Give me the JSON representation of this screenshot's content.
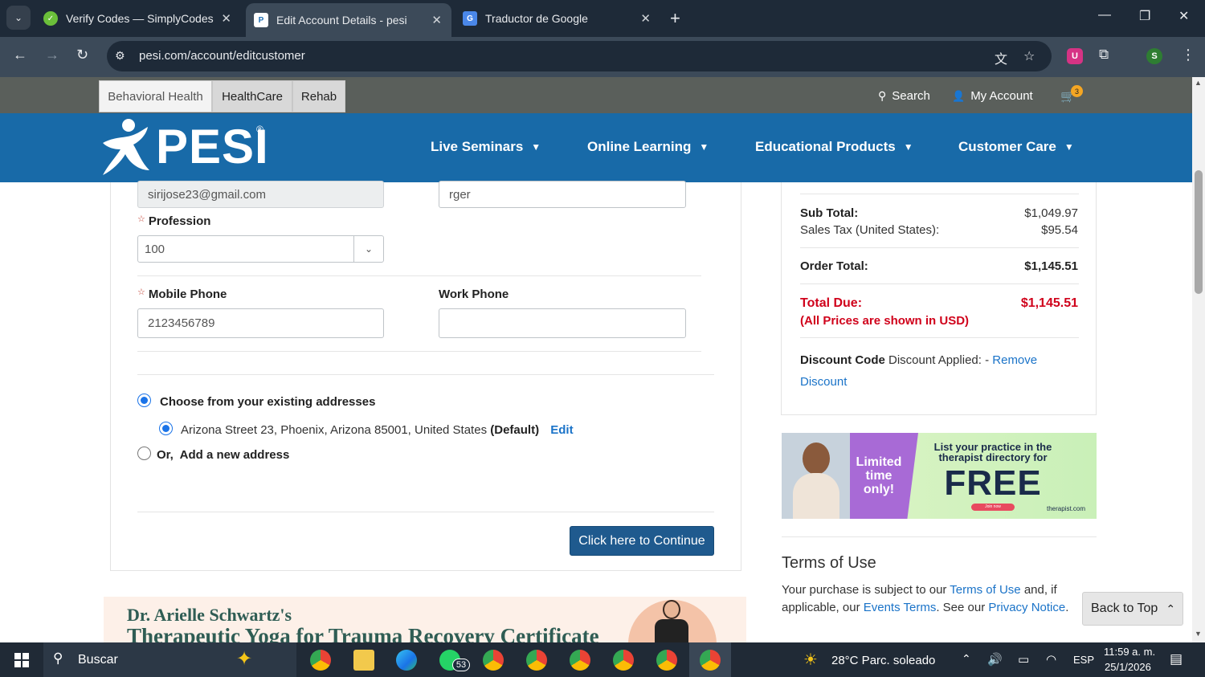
{
  "browser": {
    "tabs": [
      {
        "title": "Verify Codes — SimplyCodes",
        "favicon": "simplycodes-icon",
        "color": "#6bbf3a"
      },
      {
        "title": "Edit Account Details - pesi",
        "favicon": "pesi-icon",
        "color": "#1f6fb3"
      },
      {
        "title": "Traductor de Google",
        "favicon": "google-translate-icon",
        "color": "#4a87e8"
      }
    ],
    "url": "pesi.com/account/editcustomer",
    "profile_initial": "S",
    "shield_initial": "U"
  },
  "site": {
    "top_tabs": [
      "Behavioral Health",
      "HealthCare",
      "Rehab"
    ],
    "search_label": "Search",
    "account_label": "My Account",
    "cart_count": "3",
    "logo_text": "PESI",
    "logo_mark": "®",
    "nav": [
      "Live Seminars",
      "Online Learning",
      "Educational Products",
      "Customer Care"
    ]
  },
  "form": {
    "email_value": "sirijose23@gmail.com",
    "right_top_value": "rger",
    "profession_label": "Profession",
    "profession_value": "100",
    "mobile_label": "Mobile Phone",
    "mobile_value": "2123456789",
    "work_label": "Work Phone",
    "work_value": "",
    "choose_existing_label": "Choose from your existing addresses",
    "address_text": "Arizona Street 23, Phoenix, Arizona 85001, United States",
    "address_default": "(Default)",
    "edit_label": "Edit",
    "add_new_label": "Or,  Add a new address",
    "continue_label": "Click here to Continue"
  },
  "summary": {
    "subtotal_label": "Sub Total:",
    "subtotal_value": "$1,049.97",
    "tax_label": "Sales Tax (United States):",
    "tax_value": "$95.54",
    "order_total_label": "Order Total:",
    "order_total_value": "$1,145.51",
    "total_due_label": "Total Due:",
    "total_due_value": "$1,145.51",
    "usd_note": "(All Prices are shown in USD)",
    "discount_label": "Discount Code",
    "discount_applied": "Discount Applied: -",
    "remove_discount": "Remove Discount"
  },
  "promo": {
    "limited": "Limited time only!",
    "line1": "List your practice in the",
    "line2": "therapist directory for",
    "free": "FREE",
    "join": "Join now",
    "brand": "therapist.com"
  },
  "terms": {
    "title": "Terms of Use",
    "t1": "Your purchase is subject to our ",
    "terms_link": "Terms of Use",
    "t2": " and, if applicable, our ",
    "events_link": "Events Terms",
    "t3": ". See our ",
    "privacy_link": "Privacy Notice",
    "t4": "."
  },
  "back_to_top": "Back to Top",
  "banner": {
    "line1": "Dr. Arielle Schwartz's",
    "line2": "Therapeutic Yoga for Trauma Recovery Certificate"
  },
  "taskbar": {
    "search_label": "Buscar",
    "whatsapp_badge": "53",
    "weather": "28°C  Parc. soleado",
    "lang": "ESP",
    "time": "11:59 a. m.",
    "date": "25/1/2026"
  }
}
